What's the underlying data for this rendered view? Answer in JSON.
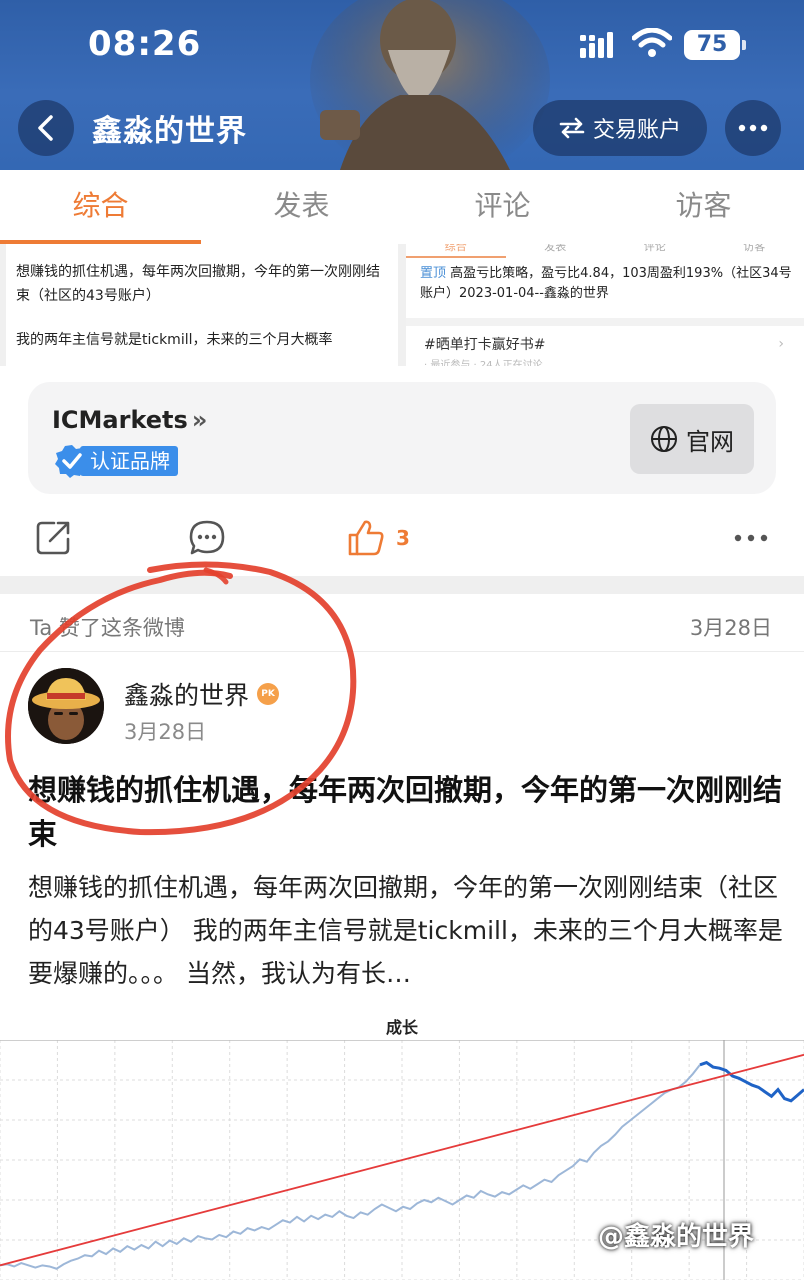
{
  "status_bar": {
    "time": "08:26",
    "battery": "75"
  },
  "header": {
    "title": "鑫淼的世界",
    "trade_button": "交易账户"
  },
  "tabs": [
    {
      "label": "综合"
    },
    {
      "label": "发表"
    },
    {
      "label": "评论"
    },
    {
      "label": "访客"
    }
  ],
  "thumbnails": {
    "left": {
      "para1": "想赚钱的抓住机遇，每年两次回撤期，今年的第一次刚刚结束（社区的43号账户）",
      "para2": "我的两年主信号就是tickmill，未来的三个月大概率"
    },
    "right": {
      "mini_tabs": [
        "综合",
        "发表",
        "评论",
        "访客"
      ],
      "pin_tag": "置顶",
      "pin_text": "高盈亏比策略，盈亏比4.84，103周盈利193%（社区34号账户）2023-01-04--鑫淼的世界",
      "topic": "#晒单打卡赢好书#",
      "topic_sub": "· 最近参与 · 24人正在讨论"
    }
  },
  "ad_card": {
    "brand": "ICMarkets",
    "badge": "认证品牌",
    "button": "官网"
  },
  "actions": {
    "like_count": "3"
  },
  "liked": {
    "label": "Ta 赞了这条微博",
    "date": "3月28日"
  },
  "post": {
    "author": "鑫淼的世界",
    "pk_badge": "PK",
    "date": "3月28日",
    "title": "想赚钱的抓住机遇，每年两次回撤期，今年的第一次刚刚结束",
    "body": "想赚钱的抓住机遇，每年两次回撤期，今年的第一次刚刚结束（社区的43号账户） 我的两年主信号就是tickmill，未来的三个月大概率是要爆赚的。。。 当然，我认为有长…"
  },
  "chart_data": {
    "type": "line",
    "title": "成长",
    "xlabel": "",
    "ylabel": "",
    "grid": true,
    "series": [
      {
        "values": [
          12,
          13,
          11,
          14,
          12,
          10,
          12,
          11,
          9,
          13,
          16,
          18,
          21,
          20,
          25,
          22,
          27,
          24,
          29,
          26,
          30,
          27,
          33,
          29,
          34,
          31,
          36,
          33,
          38,
          36,
          35,
          39,
          37,
          42,
          40,
          45,
          43,
          46,
          44,
          48,
          52,
          50,
          55,
          51,
          56,
          53,
          57,
          55,
          60,
          56,
          54,
          59,
          57,
          62,
          66,
          63,
          60,
          64,
          62,
          67,
          70,
          68,
          72,
          69,
          66,
          70,
          74,
          72,
          78,
          75,
          73,
          77,
          75,
          79,
          83,
          80,
          84,
          88,
          86,
          92,
          96,
          100,
          106,
          104,
          112,
          118,
          122,
          128,
          135,
          140,
          145,
          150,
          155,
          160,
          165,
          168,
          170,
          175,
          182,
          190
        ],
        "color": "#9db7d8"
      },
      {
        "values": [
          190,
          192,
          188,
          187,
          185,
          180,
          178,
          175,
          172,
          170,
          166,
          162,
          168,
          160,
          158,
          163,
          168
        ],
        "color": "#1f63c6"
      },
      {
        "values": [
          12,
          190
        ],
        "color": "#e53b3b"
      }
    ]
  },
  "watermark": "@鑫淼的世界"
}
